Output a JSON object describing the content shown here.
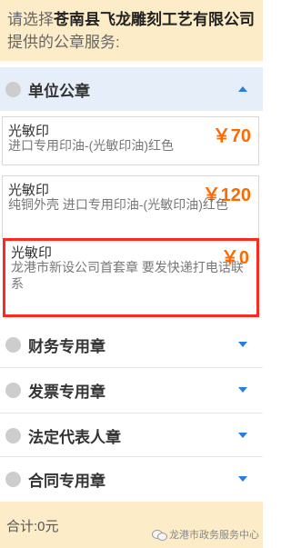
{
  "intro": {
    "prefix": "请选择",
    "company": "苍南县飞龙雕刻工艺有限公司",
    "suffix": "提供的公章服务:"
  },
  "sections": [
    {
      "title": "单位公章",
      "expanded": true,
      "items": [
        {
          "name": "光敏印",
          "desc": "进口专用印油-(光敏印油)红色",
          "price": "￥70"
        },
        {
          "name": "光敏印",
          "desc": "纯铜外壳 进口专用印油-(光敏印油)红色",
          "price": "￥120"
        },
        {
          "name": "光敏印",
          "desc": "龙港市新设公司首套章 要发快递打电话联系",
          "price": "￥0",
          "highlighted": true
        }
      ]
    },
    {
      "title": "财务专用章",
      "expanded": false
    },
    {
      "title": "发票专用章",
      "expanded": false
    },
    {
      "title": "法定代表人章",
      "expanded": false
    },
    {
      "title": "合同专用章",
      "expanded": false
    }
  ],
  "footer": {
    "total_label": "合计:0元",
    "watermark": "龙港市政务服务中心"
  },
  "colors": {
    "banner_bg": "#fcecc7",
    "open_section_bg": "#e6eef9",
    "price": "#ff6a00",
    "highlight_border": "#ff2a1f",
    "arrow": "#2a7de0"
  },
  "icons": [
    "radio-dot-icon",
    "chevron-up-icon",
    "chevron-down-icon",
    "wechat-icon"
  ]
}
